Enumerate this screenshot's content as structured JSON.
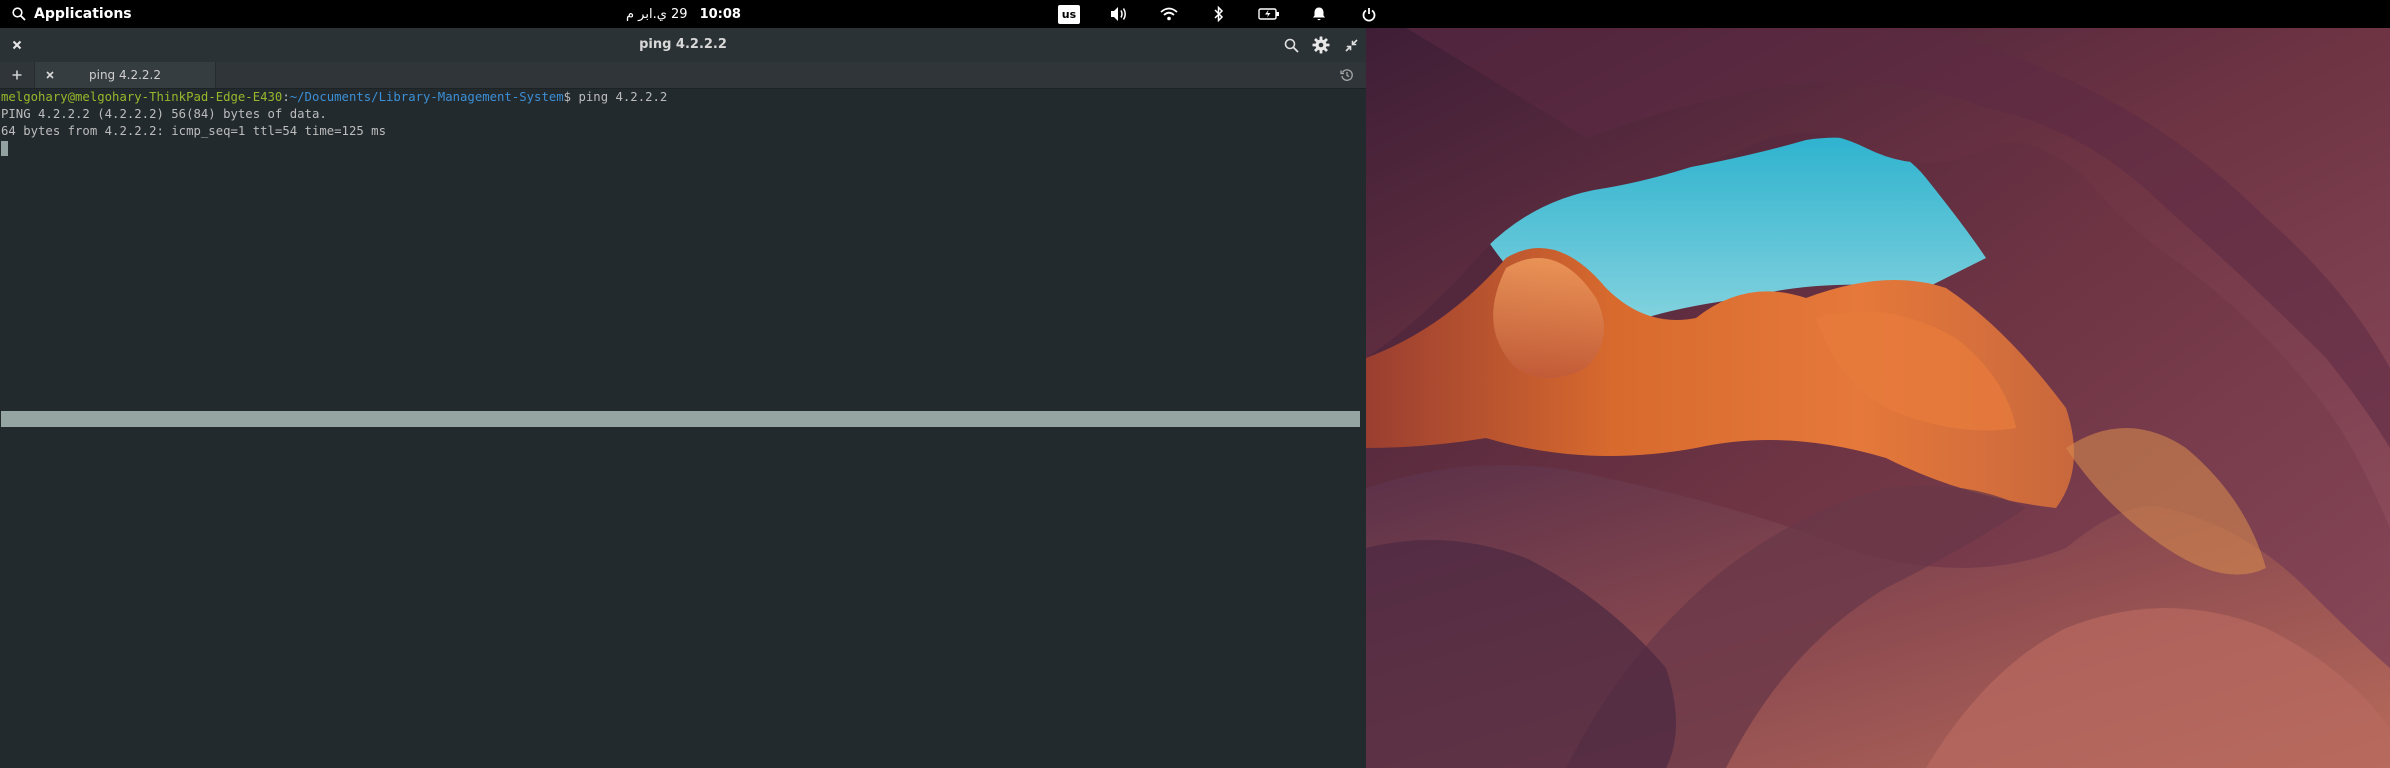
{
  "panel": {
    "applications_label": "Applications",
    "time": "10:08",
    "date": "29 ي.ابر م",
    "keyboard_layout": "us"
  },
  "window": {
    "title": "ping 4.2.2.2"
  },
  "tabs": [
    {
      "label": "ping 4.2.2.2"
    }
  ],
  "terminal": {
    "prompt_user": "melgohary@melgohary-ThinkPad-Edge-E430",
    "prompt_sep": ":",
    "prompt_path": "~/Documents/Library-Management-System",
    "prompt_dollar": "$",
    "command": " ping 4.2.2.2",
    "output": [
      "PING 4.2.2.2 (4.2.2.2) 56(84) bytes of data.",
      "64 bytes from 4.2.2.2: icmp_seq=1 ttl=54 time=125 ms"
    ]
  },
  "colors": {
    "terminal_bg": "#232a2e",
    "prompt_user": "#96b82b",
    "prompt_path": "#3b8fd6",
    "text": "#bcbcbc"
  }
}
